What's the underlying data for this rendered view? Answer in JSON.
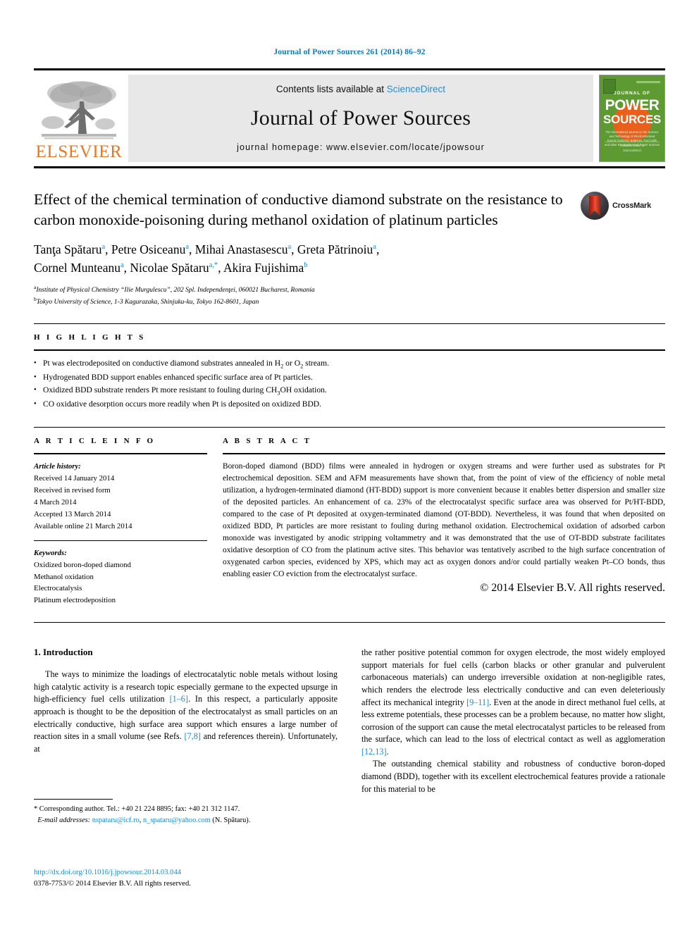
{
  "running_head": "Journal of Power Sources 261 (2014) 86–92",
  "masthead": {
    "contents_prefix": "Contents lists available at",
    "sciencedirect": "ScienceDirect",
    "journal_name": "Journal of Power Sources",
    "homepage": "journal homepage: www.elsevier.com/locate/jpowsour",
    "publisher": "ELSEVIER",
    "cover": {
      "journal_of": "JOURNAL OF",
      "power": "POWER",
      "sources": "SOURCES",
      "blurb": "The International Journal on the Science and Technology of Electrochemical Energy Systems: Batteries, Fuel Cells and other Electrochemical Power Sources",
      "foot_top": "Available online at",
      "foot_bottom": "ScienceDirect"
    }
  },
  "article": {
    "title": "Effect of the chemical termination of conductive diamond substrate on the resistance to carbon monoxide-poisoning during methanol oxidation of platinum particles",
    "crossmark_label": "CrossMark",
    "authors_line1": "Tanţa Spătaru",
    "authors": [
      {
        "name": "Tanţa Spătaru",
        "mark": "a"
      },
      {
        "name": "Petre Osiceanu",
        "mark": "a"
      },
      {
        "name": "Mihai Anastasescu",
        "mark": "a"
      },
      {
        "name": "Greta Pătrinoiu",
        "mark": "a"
      },
      {
        "name": "Cornel Munteanu",
        "mark": "a"
      },
      {
        "name": "Nicolae Spătaru",
        "mark": "a,*"
      },
      {
        "name": "Akira Fujishima",
        "mark": "b"
      }
    ],
    "affiliations": [
      {
        "mark": "a",
        "text": "Institute of Physical Chemistry “Ilie Murgulescu”, 202 Spl. Independenţei, 060021 Bucharest, Romania"
      },
      {
        "mark": "b",
        "text": "Tokyo University of Science, 1-3 Kagurazaka, Shinjuku-ku, Tokyo 162-8601, Japan"
      }
    ]
  },
  "highlights": {
    "label": "H I G H L I G H T S",
    "items": [
      "Pt was electrodeposited on conductive diamond substrates annealed in H2 or O2 stream.",
      "Hydrogenated BDD support enables enhanced specific surface area of Pt particles.",
      "Oxidized BDD substrate renders Pt more resistant to fouling during CH3OH oxidation.",
      "CO oxidative desorption occurs more readily when Pt is deposited on oxidized BDD."
    ]
  },
  "article_info": {
    "label": "A R T I C L E  I N F O",
    "history_label": "Article history:",
    "history": [
      "Received 14 January 2014",
      "Received in revised form",
      "4 March 2014",
      "Accepted 13 March 2014",
      "Available online 21 March 2014"
    ],
    "keywords_label": "Keywords:",
    "keywords": [
      "Oxidized boron-doped diamond",
      "Methanol oxidation",
      "Electrocatalysis",
      "Platinum electrodeposition"
    ]
  },
  "abstract": {
    "label": "A B S T R A C T",
    "text": "Boron-doped diamond (BDD) films were annealed in hydrogen or oxygen streams and were further used as substrates for Pt electrochemical deposition. SEM and AFM measurements have shown that, from the point of view of the efficiency of noble metal utilization, a hydrogen-terminated diamond (HT-BDD) support is more convenient because it enables better dispersion and smaller size of the deposited particles. An enhancement of ca. 23% of the electrocatalyst specific surface area was observed for Pt/HT-BDD, compared to the case of Pt deposited at oxygen-terminated diamond (OT-BDD). Nevertheless, it was found that when deposited on oxidized BDD, Pt particles are more resistant to fouling during methanol oxidation. Electrochemical oxidation of adsorbed carbon monoxide was investigated by anodic stripping voltammetry and it was demonstrated that the use of OT-BDD substrate facilitates oxidative desorption of CO from the platinum active sites. This behavior was tentatively ascribed to the high surface concentration of oxygenated carbon species, evidenced by XPS, which may act as oxygen donors and/or could partially weaken Pt–CO bonds, thus enabling easier CO eviction from the electrocatalyst surface.",
    "copyright": "© 2014 Elsevier B.V. All rights reserved."
  },
  "introduction": {
    "heading": "1. Introduction",
    "left_para_1_a": "The ways to minimize the loadings of electrocatalytic noble metals without losing high catalytic activity is a research topic especially germane to the expected upsurge in high-efficiency fuel cells utilization ",
    "left_cite_1": "[1–6]",
    "left_para_1_b": ". In this respect, a particularly apposite approach is thought to be the deposition of the electrocatalyst as small particles on an electrically conductive, high surface area support which ensures a large number of reaction sites in a small volume (see Refs. ",
    "left_cite_2": "[7,8]",
    "left_para_1_c": " and references therein). Unfortunately, at",
    "right_para_1_a": "the rather positive potential common for oxygen electrode, the most widely employed support materials for fuel cells (carbon blacks or other granular and pulverulent carbonaceous materials) can undergo irreversible oxidation at non-negligible rates, which renders the electrode less electrically conductive and can even deleteriously affect its mechanical integrity ",
    "right_cite_1": "[9–11]",
    "right_para_1_b": ". Even at the anode in direct methanol fuel cells, at less extreme potentials, these processes can be a problem because, no matter how slight, corrosion of the support can cause the metal electrocatalyst particles to be released from the surface, which can lead to the loss of electrical contact as well as agglomeration ",
    "right_cite_2": "[12,13]",
    "right_para_1_c": ".",
    "right_para_2": "The outstanding chemical stability and robustness of conductive boron-doped diamond (BDD), together with its excellent electrochemical features provide a rationale for this material to be"
  },
  "footnote": {
    "star_line": "* Corresponding author. Tel.: +40 21 224 8895; fax: +40 21 312 1147.",
    "email_label": "E-mail addresses:",
    "email1": "nspataru@icf.ro",
    "email_sep": ", ",
    "email2": "n_spataru@yahoo.com",
    "email_suffix": " (N. Spătaru)."
  },
  "page_footer": {
    "doi": "http://dx.doi.org/10.1016/j.jpowsour.2014.03.044",
    "issn_line": "0378-7753/© 2014 Elsevier B.V. All rights reserved."
  },
  "colors": {
    "link_blue": "#1c8cc4",
    "sciencedirect_blue": "#2a8ec4",
    "elsevier_orange": "#E87722",
    "cover_green": "#5d9b32",
    "cover_orange": "#e8601c"
  }
}
